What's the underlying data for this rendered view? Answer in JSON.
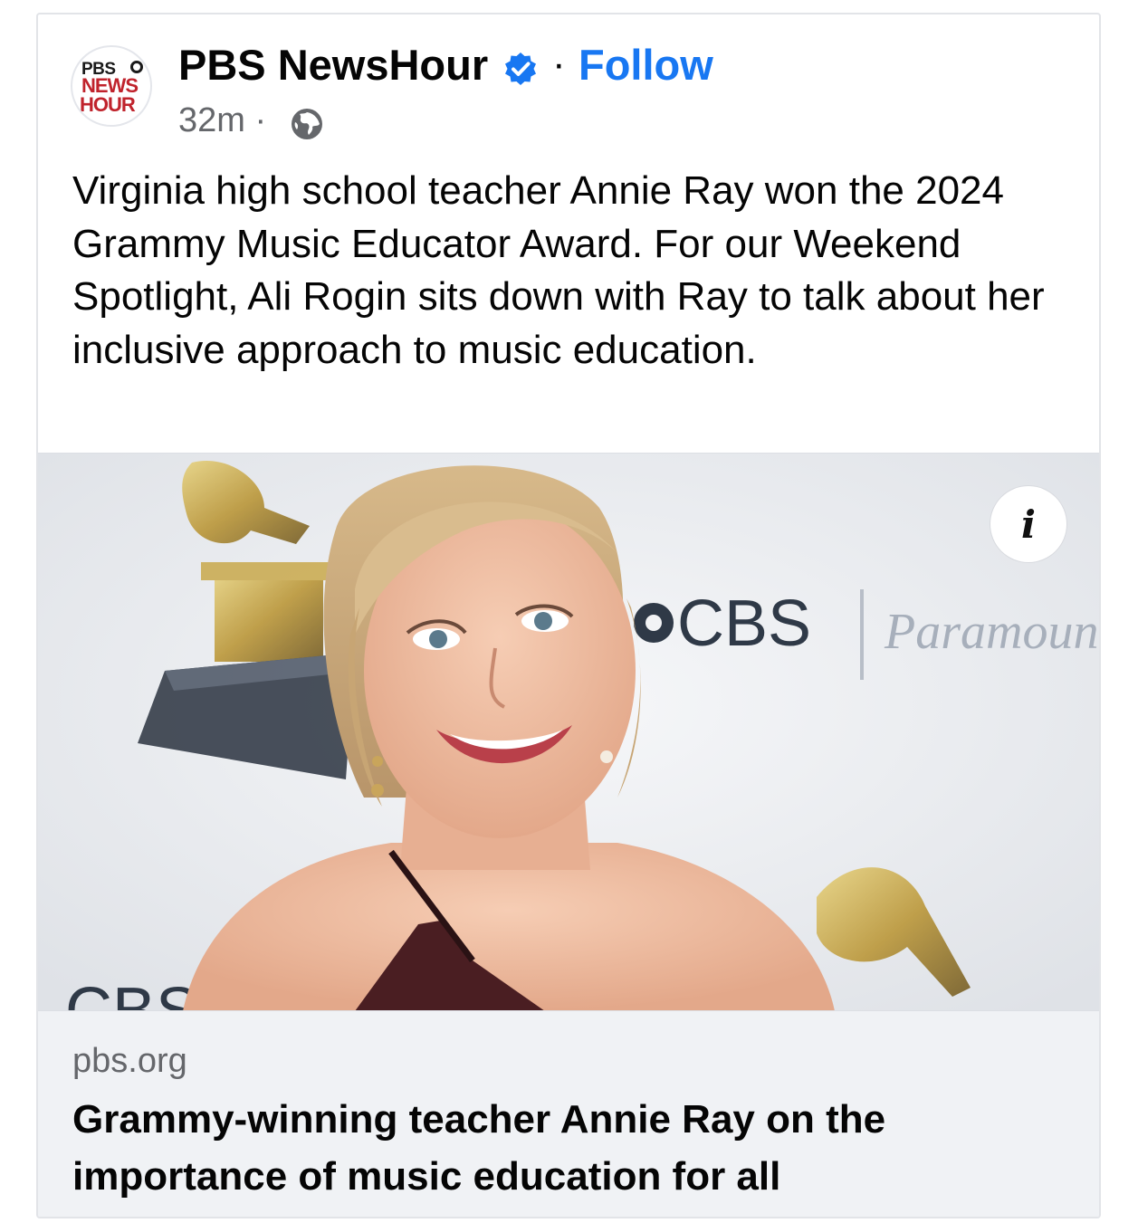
{
  "post": {
    "page_name": "PBS NewsHour",
    "separator": "·",
    "follow_label": "Follow",
    "time": "32m ·",
    "avatar": {
      "line1": "PBS",
      "line2": "NEWS",
      "line3": "HOUR"
    },
    "text": "Virginia high school teacher Annie Ray won the 2024 Grammy Music Educator Award. For our Weekend Spotlight, Ali Rogin sits down with Ray to talk about her inclusive approach to music education.",
    "icons": {
      "verified": "verified-badge-icon",
      "audience": "globe-icon",
      "info": "info-icon"
    }
  },
  "photo": {
    "backdrop_text_1": "CBS",
    "backdrop_text_2": "Paramount",
    "backdrop_text_3": "CBS",
    "info_label": "i"
  },
  "link_preview": {
    "domain": "pbs.org",
    "headline": "Grammy-winning teacher Annie Ray on the importance of music education for all"
  },
  "colors": {
    "accent": "#1877f2",
    "pbs_red": "#c0232c",
    "text": "#050505",
    "secondary": "#65676b",
    "link_bg": "#f0f2f5"
  }
}
